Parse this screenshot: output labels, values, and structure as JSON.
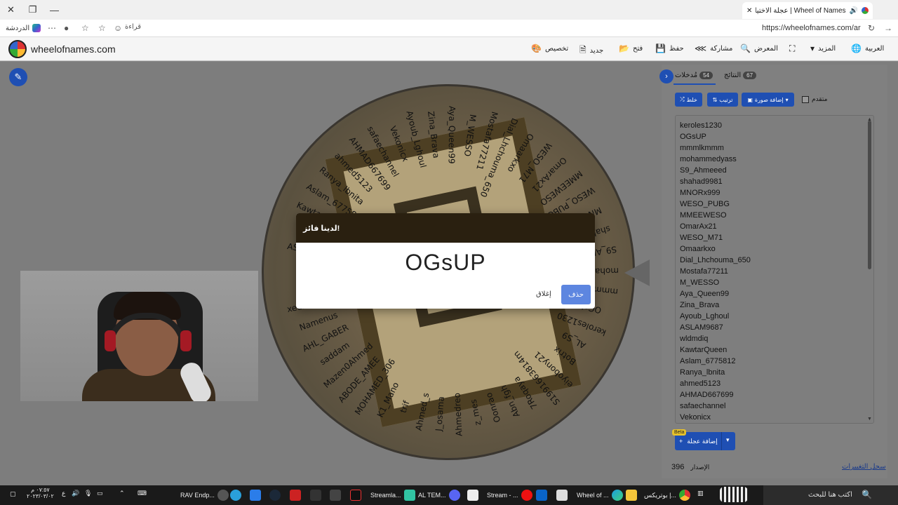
{
  "browser": {
    "tab_title": "Wheel of Names | عجلة الاختيار العشوائي",
    "url": "https://wheelofnames.com/ar",
    "chat_label": "الدردشة",
    "reader_label": "قراءة"
  },
  "site": {
    "name": "wheelofnames.com",
    "nav": {
      "customize": "تخصيص",
      "new": "جديد",
      "open": "فتح",
      "save": "حفظ",
      "share": "مشاركة",
      "gallery": "المعرض",
      "more": "المزيد",
      "language": "العربية"
    }
  },
  "wheel": {
    "labels_left": [
      "ASLAM9687",
      "wldmdiq",
      "KawtarQueen",
      "Aslam_6775812",
      "Ranya_lbnita",
      "ahmed5123",
      "AHMAD667699",
      "safaechannel",
      "Vekonicx"
    ],
    "labels_top": [
      "Ayoub_Lghoul",
      "Zina_Brava",
      "Aya_Queen99",
      "M_WESSO",
      "Mostafa77211",
      "Dial_Lhchouma_650",
      "Omaarkxo",
      "WESO_M71",
      "OmarAx21",
      "MMEEWESO",
      "WESO_PUBG",
      "MNORx999",
      "shahad9981"
    ],
    "labels_right": [
      "S9_Ahmeeed",
      "mohammedyass",
      "mmmlkmmm",
      "OGsUP",
      "keroles1230",
      "AL_S9",
      "Botrix",
      "eiyobony21"
    ],
    "labels_bottom": [
      "S1991663814m",
      "7Roqaya",
      "Abn_fgh",
      "Oonrao",
      "z_mes",
      "Ahmedreo",
      "J_osama",
      "Ahmed_s",
      "trif",
      "K1_Mano",
      "MOHAMED_306",
      "ABODE_AMEE",
      "Mazen0Ahmed",
      "saddam",
      "AHL_GABER",
      "Namenus",
      "xedzumnega",
      "pasel",
      "weso"
    ]
  },
  "panel": {
    "entries_tab": "مُدخلات",
    "entries_count": "54",
    "results_tab": "النتائج",
    "results_count": "67",
    "shuffle": "خلط",
    "sort": "ترتيب",
    "add_image": "إضافة صورة",
    "advanced": "متقدم",
    "entries": [
      "keroles1230",
      "OGsUP",
      "mmmlkmmm",
      "mohammedyass",
      "S9_Ahmeeed",
      "shahad9981",
      "MNORx999",
      "WESO_PUBG",
      "MMEEWESO",
      "OmarAx21",
      "WESO_M71",
      "Omaarkxo",
      "Dial_Lhchouma_650",
      "Mostafa77211",
      "M_WESSO",
      "Aya_Queen99",
      "Zina_Brava",
      "Ayoub_Lghoul",
      "ASLAM9687",
      "wldmdiq",
      "KawtarQueen",
      "Aslam_6775812",
      "Ranya_lbnita",
      "ahmed5123",
      "AHMAD667699",
      "safaechannel",
      "Vekonicx"
    ],
    "add_wheel": "إضافة عجلة",
    "beta": "Beta",
    "version_label": "الإصدار",
    "version": "396",
    "changelog": "سجل التغييرات"
  },
  "dialog": {
    "title": "لدينا فائز!",
    "winner": "OGsUP",
    "close": "إغلاق",
    "remove": "حذف"
  },
  "taskbar": {
    "search_placeholder": "اكتب هنا للبحث",
    "items": [
      "بوتريكس |...",
      "Wheel of ...",
      "Stream - ...",
      "AL TEM...",
      "Streamla...",
      "RAV Endp..."
    ],
    "time": "٠٧:٥٧ م",
    "date": "٢٠٢٣/٠٣/٠٢",
    "lang": "ع"
  }
}
